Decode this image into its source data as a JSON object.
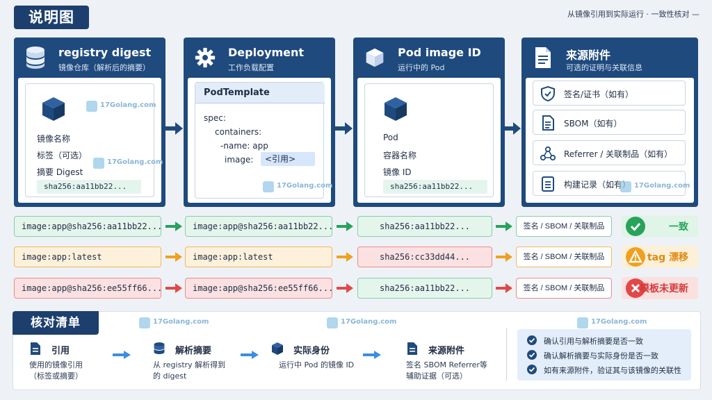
{
  "header": {
    "title": "说明图",
    "note": "从镜像引用到实际运行 · 一致性核对 —"
  },
  "cards": [
    {
      "title": "registry digest",
      "subtitle": "镜像仓库（解析后的摘要）",
      "icon": "database-icon",
      "fields": [
        "镜像名称",
        "标签（可选）",
        "摘要 Digest"
      ],
      "hash": "sha256:aa11bb22..."
    },
    {
      "title": "Deployment",
      "subtitle": "工作负载配置",
      "icon": "gear-icon",
      "template_title": "PodTemplate",
      "code_lines": [
        "spec:",
        "containers:",
        "-name: app",
        "image:"
      ],
      "ref": "<引用>"
    },
    {
      "title": "Pod image ID",
      "subtitle": "运行中的 Pod",
      "icon": "cube-icon",
      "fields": [
        "Pod",
        "容器名称",
        "镜像 ID"
      ],
      "hash": "sha256:aa11bb22..."
    },
    {
      "title": "来源附件",
      "subtitle": "可选的证明与关联信息",
      "icon": "document-icon",
      "items": [
        "签名/证书（如有）",
        "SBOM（如有）",
        "Referrer / 关联制品（如有）",
        "构建记录（如有）"
      ]
    }
  ],
  "rows": [
    {
      "ref": "image:app@sha256:aa11bb22...",
      "deploy": "image:app@sha256:aa11bb22...",
      "pod": "sha256:aa11bb22...",
      "source": "签名 / SBOM / 关联制品",
      "status": "一致",
      "tone": "green",
      "color": "#27a35a"
    },
    {
      "ref": "image:app:latest",
      "deploy": "image:app:latest",
      "pod": "sha256:cc33dd44...",
      "source": "签名 / SBOM / 关联制品",
      "status": "tag 漂移",
      "tone": "orange",
      "color": "#f0a020"
    },
    {
      "ref": "image:app@sha256:ee55ff66...",
      "deploy": "image:app@sha256:ee55ff66...",
      "pod": "sha256:aa11bb22...",
      "source": "签名 / SBOM / 关联制品",
      "status": "模板未更新",
      "tone": "red",
      "color": "#e24848"
    }
  ],
  "checklist": {
    "title": "核对清单",
    "steps": [
      {
        "title": "引用",
        "desc": [
          "使用的镜像引用",
          "（标签或摘要）"
        ]
      },
      {
        "title": "解析摘要",
        "desc": [
          "从 registry 解析得到",
          "的 digest"
        ]
      },
      {
        "title": "实际身份",
        "desc": [
          "运行中 Pod 的镜像 ID"
        ]
      },
      {
        "title": "来源附件",
        "desc": [
          "签名  SBOM  Referrer等",
          "辅助证据（可选）"
        ]
      }
    ],
    "checks": [
      "确认引用与解析摘要是否一致",
      "确认解析摘要与实际身份是否一致",
      "如有来源附件，验证其与该镜像的关联性"
    ]
  },
  "watermark": "17Golang.com",
  "colors": {
    "navy": "#1f4a7d",
    "green": "#27a35a",
    "orange": "#f0a020",
    "red": "#e24848"
  }
}
